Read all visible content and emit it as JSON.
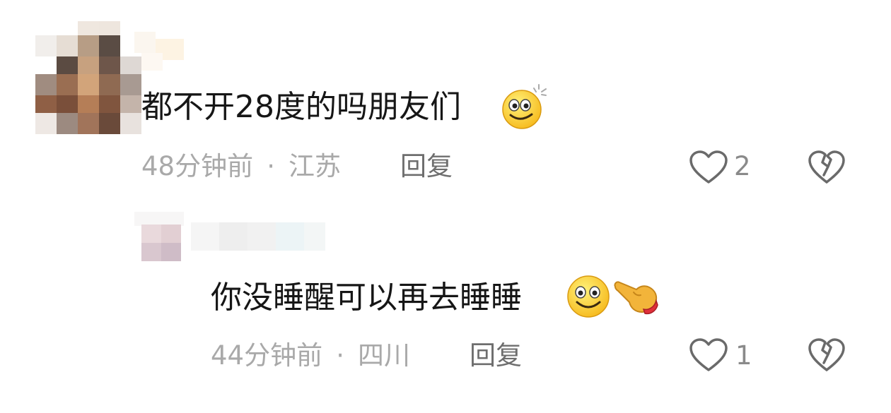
{
  "comments": [
    {
      "text": "都不开28度的吗朋友们",
      "emoji_icons": [
        "smiley-wink-emoji-icon"
      ],
      "time": "48分钟前",
      "separator": "·",
      "location": "江苏",
      "reply_label": "回复",
      "like_count": "2"
    },
    {
      "text": "你没睡醒可以再去睡睡",
      "emoji_icons": [
        "smiley-emoji-icon",
        "pointing-hand-emoji-icon"
      ],
      "time": "44分钟前",
      "separator": "·",
      "location": "四川",
      "reply_label": "回复",
      "like_count": "1"
    }
  ],
  "icons": {
    "like": "heart-outline-icon",
    "dislike": "broken-heart-icon"
  },
  "colors": {
    "text": "#161616",
    "meta": "#a9a9a9",
    "reply": "#6e6e6e",
    "icon_stroke": "#6a6a6a",
    "emoji_face": "#ffd23f",
    "emoji_hand": "#f0b030"
  }
}
